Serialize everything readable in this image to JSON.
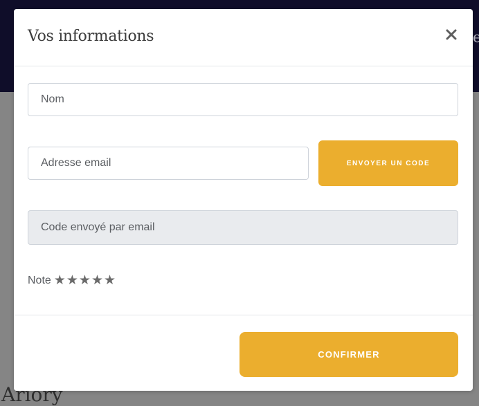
{
  "background": {
    "peek_right": "e",
    "peek_bottom": "Ariory"
  },
  "modal": {
    "title": "Vos informations",
    "close_icon": "close-icon"
  },
  "form": {
    "name_placeholder": "Nom",
    "email_placeholder": "Adresse email",
    "send_code_label": "Envoyer un code",
    "code_placeholder": "Code envoyé par email",
    "rating_label": "Note",
    "rating_max": 5,
    "rating_value": 0,
    "stars": [
      "★",
      "★",
      "★",
      "★",
      "★"
    ]
  },
  "footer": {
    "confirm_label": "Confirmer"
  },
  "colors": {
    "accent": "#ebae2e",
    "overlay": "#858585",
    "topbar": "#0f0d29",
    "disabled_input": "#e9ebee"
  }
}
